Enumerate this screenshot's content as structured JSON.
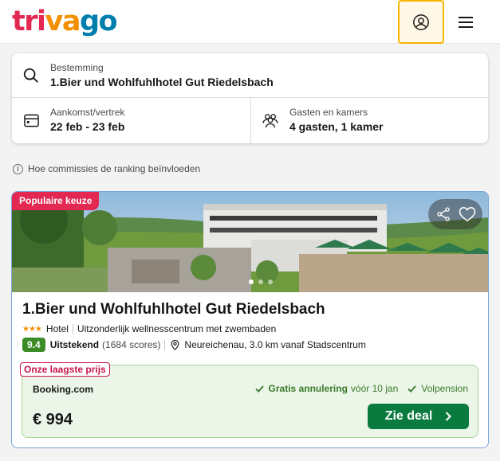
{
  "header": {
    "logo": {
      "part1": "tri",
      "part2": "va",
      "part3": "go"
    },
    "profile_icon": "user-circle-icon",
    "menu_icon": "hamburger-menu-icon"
  },
  "search": {
    "destination": {
      "label": "Bestemming",
      "value": "1.Bier und Wohlfuhlhotel Gut Riedelsbach"
    },
    "dates": {
      "label": "Aankomst/vertrek",
      "value": "22 feb - 23 feb"
    },
    "guests": {
      "label": "Gasten en kamers",
      "value": "4 gasten, 1 kamer"
    }
  },
  "info_link": "Hoe commissies de ranking beïnvloeden",
  "hotel": {
    "badge": "Populaire keuze",
    "name": "1.Bier und Wohlfuhlhotel Gut Riedelsbach",
    "stars": 3,
    "type": "Hotel",
    "description": "Uitzonderlijk wellnesscentrum met zwembaden",
    "rating": {
      "score": "9.4",
      "label": "Uitstekend",
      "count": "(1684 scores)"
    },
    "location": "Neureichenau, 3.0 km vanaf Stadscentrum",
    "photo_dots": 3,
    "active_dot": 0
  },
  "deal": {
    "badge": "Onze laagste prijs",
    "provider": "Booking.com",
    "perk1_strong": "Gratis annulering",
    "perk1_date": "vóór 10 jan",
    "perk2": "Volpension",
    "price": "€ 994",
    "button": "Zie deal"
  },
  "colors": {
    "brand_red": "#e32851",
    "brand_orange": "#f48f00",
    "brand_blue": "#007fad",
    "deal_green": "#0a7b3e",
    "rating_green": "#3b8b27"
  }
}
